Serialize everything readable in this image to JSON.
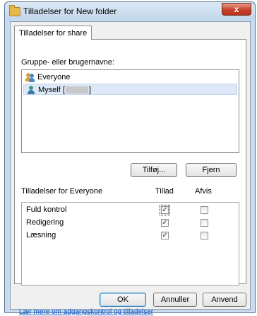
{
  "window": {
    "title": "Tilladelser for New folder",
    "close_label": "x"
  },
  "tab": {
    "label": "Tilladelser for share"
  },
  "groups": {
    "label": "Gruppe- eller brugernavne:",
    "items": [
      {
        "name": "Everyone",
        "icon": "group-users-icon"
      },
      {
        "name": "Myself [",
        "suffix": "]",
        "icon": "user-icon"
      }
    ]
  },
  "buttons": {
    "add": "Tilføj...",
    "remove": "Fjern",
    "ok": "OK",
    "cancel": "Annuller",
    "apply": "Anvend"
  },
  "permissions": {
    "label": "Tilladelser for Everyone",
    "allow_header": "Tillad",
    "deny_header": "Afvis",
    "rows": [
      {
        "name": "Fuld kontrol",
        "allow": true,
        "deny": false
      },
      {
        "name": "Redigering",
        "allow": true,
        "deny": false
      },
      {
        "name": "Læsning",
        "allow": true,
        "deny": false
      }
    ]
  },
  "link": "Lær mere om adgangskontrol og tilladelser",
  "check_glyph": "✓"
}
